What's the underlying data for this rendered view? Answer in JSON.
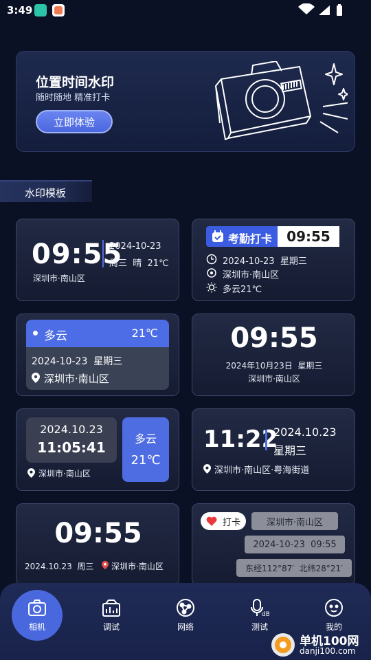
{
  "status_bar": {
    "time": "3:49"
  },
  "banner": {
    "title": "位置时间水印",
    "subtitle": "随时随地 精准打卡",
    "cta": "立即体验"
  },
  "section": {
    "label": "水印模板"
  },
  "templates": {
    "t1": {
      "time": "09:55",
      "date": "2024-10-23",
      "weekday_weather": "周三  晴  21℃",
      "location": "深圳市·南山区"
    },
    "t2": {
      "tag": "考勤打卡",
      "time": "09:55",
      "date": "2024-10-23  星期三",
      "location": "深圳市·南山区",
      "weather": "多云21℃"
    },
    "t3": {
      "weather": "多云",
      "temp": "21℃",
      "date": "2024-10-23  星期三",
      "location": "深圳市·南山区"
    },
    "t4": {
      "time": "09:55",
      "date": "2024年10月23日  星期三",
      "location": "深圳市·南山区"
    },
    "t5": {
      "date": "2024.10.23",
      "time": "11:05:41",
      "weather": "多云",
      "temp": "21℃",
      "location": "深圳市·南山区"
    },
    "t6": {
      "time": "11:22",
      "date": "2024.10.23",
      "weekday": "星期三",
      "location": "深圳市·南山区·粤海街道"
    },
    "t7": {
      "time": "09:55",
      "date_weekday": "2024.10.23  周三",
      "location": "深圳市·南山区"
    },
    "t8": {
      "tag": "打卡",
      "location": "深圳市·南山区",
      "datetime": "2024-10-23  09:55",
      "coords": "东经112°87′  北纬28°21′"
    }
  },
  "nav": {
    "items": [
      {
        "label": "相机",
        "icon": "camera-icon"
      },
      {
        "label": "调试",
        "icon": "debug-icon"
      },
      {
        "label": "网络",
        "icon": "network-icon"
      },
      {
        "label": "测试",
        "icon": "db-test-icon"
      },
      {
        "label": "我的",
        "icon": "profile-icon"
      }
    ]
  },
  "watermark": {
    "cn": "单机100网",
    "url": "danji100.com"
  }
}
